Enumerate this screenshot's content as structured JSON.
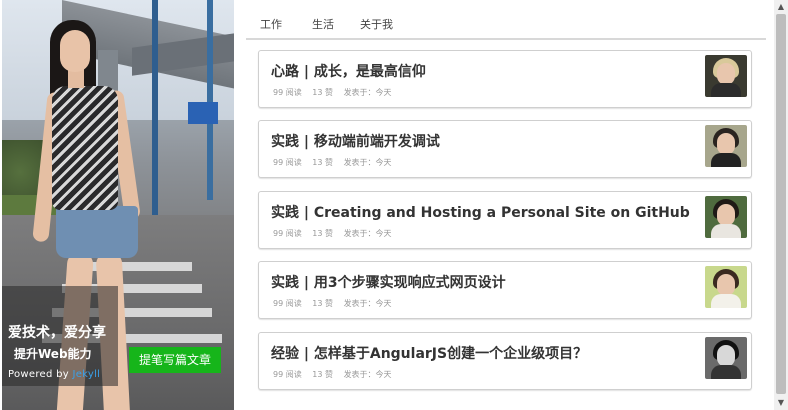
{
  "hero": {
    "slogan_line1": "爱技术，爱分享",
    "slogan_line2": "提升Web能力",
    "powered_by": "Powered by ",
    "powered_name": "Jekyll",
    "write_button": "提笔写篇文章",
    "button_color": "#16b51a"
  },
  "nav": {
    "items": [
      {
        "label": "工作"
      },
      {
        "label": "生活"
      },
      {
        "label": "关于我"
      }
    ]
  },
  "posts": [
    {
      "title": "心路 | 成长，是最高信仰",
      "reads": "99 阅读",
      "likes": "13 赞",
      "date": "发表于：今天"
    },
    {
      "title": "实践 | 移动端前端开发调试",
      "reads": "99 阅读",
      "likes": "13 赞",
      "date": "发表于：今天"
    },
    {
      "title": "实践 | Creating and Hosting a Personal Site on GitHub",
      "reads": "99 阅读",
      "likes": "13 赞",
      "date": "发表于：今天"
    },
    {
      "title": "实践 | 用3个步骤实现响应式网页设计",
      "reads": "99 阅读",
      "likes": "13 赞",
      "date": "发表于：今天"
    },
    {
      "title": "经验 | 怎样基于AngularJS创建一个企业级项目？",
      "reads": "99 阅读",
      "likes": "13 赞",
      "date": "发表于：今天"
    }
  ],
  "scrollbar": {
    "up_icon": "▲",
    "down_icon": "▼"
  }
}
